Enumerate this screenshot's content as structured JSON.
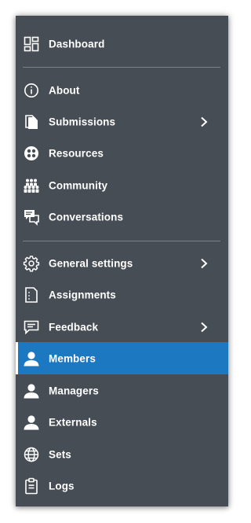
{
  "menu": {
    "items": [
      {
        "label": "Dashboard"
      },
      {
        "label": "About"
      },
      {
        "label": "Submissions"
      },
      {
        "label": "Resources"
      },
      {
        "label": "Community"
      },
      {
        "label": "Conversations"
      },
      {
        "label": "General settings"
      },
      {
        "label": "Assignments"
      },
      {
        "label": "Feedback"
      },
      {
        "label": "Members"
      },
      {
        "label": "Managers"
      },
      {
        "label": "Externals"
      },
      {
        "label": "Sets"
      },
      {
        "label": "Logs"
      }
    ]
  },
  "colors": {
    "panel_bg": "#474d55",
    "active_bg": "#1d78c2",
    "text": "#ffffff",
    "divider": "#7a8088"
  }
}
